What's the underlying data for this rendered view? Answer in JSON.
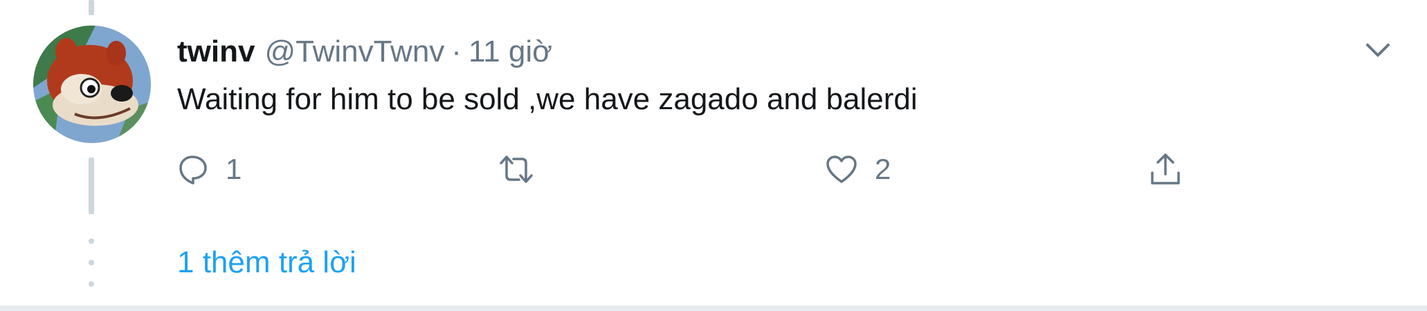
{
  "tweet": {
    "display_name": "twinv",
    "handle": "@TwinvTwnv",
    "separator": "·",
    "timestamp": "11 giờ",
    "text": "Waiting for him to be sold ,we have zagado and balerdi",
    "more_menu_icon": "chevron-down-icon",
    "avatar_description": "cartoon-chipmunk-avatar"
  },
  "actions": {
    "reply": {
      "icon": "reply-icon",
      "count": "1"
    },
    "retweet": {
      "icon": "retweet-icon",
      "count": ""
    },
    "like": {
      "icon": "heart-icon",
      "count": "2"
    },
    "share": {
      "icon": "share-icon"
    }
  },
  "more_replies_label": "1 thêm trả lời",
  "colors": {
    "text_primary": "#14171a",
    "text_secondary": "#657786",
    "accent": "#1da1f2",
    "thread_line": "#ccd6dd",
    "border": "#e6ecf0"
  }
}
